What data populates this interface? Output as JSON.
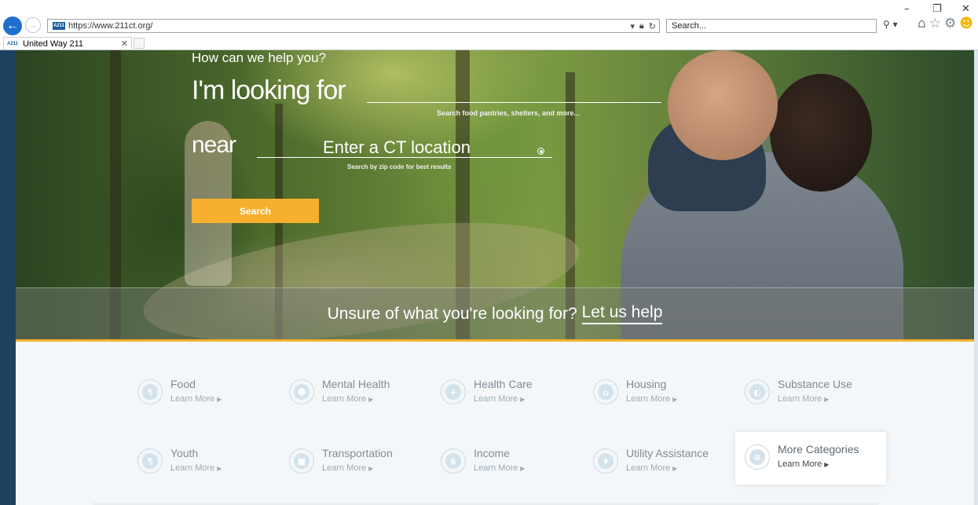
{
  "browser": {
    "url": "https://www.211ct.org/",
    "search_placeholder": "Search...",
    "tab_title": "United Way 211",
    "favicon_text": "A211"
  },
  "hero": {
    "question": "How can we help you?",
    "looking_label": "I'm looking for",
    "looking_hint": "Search food pantries, shelters, and more...",
    "near_label": "near",
    "location_placeholder": "Enter a CT location",
    "location_hint": "Search by zip code for best results",
    "search_button": "Search"
  },
  "help_band": {
    "text": "Unsure of what you're looking for?",
    "link": "Let us help"
  },
  "categories": {
    "learn_more": "Learn More",
    "items": [
      {
        "title": "Food",
        "icon": "utensils-icon",
        "glyph": "¶"
      },
      {
        "title": "Mental Health",
        "icon": "head-icon",
        "glyph": "☻"
      },
      {
        "title": "Health Care",
        "icon": "medical-kit-icon",
        "glyph": "+"
      },
      {
        "title": "Housing",
        "icon": "house-icon",
        "glyph": "⌂"
      },
      {
        "title": "Substance Use",
        "icon": "pill-icon",
        "glyph": "◐"
      },
      {
        "title": "Youth",
        "icon": "children-icon",
        "glyph": "¶"
      },
      {
        "title": "Transportation",
        "icon": "bus-icon",
        "glyph": "■"
      },
      {
        "title": "Income",
        "icon": "coin-icon",
        "glyph": "$"
      },
      {
        "title": "Utility Assistance",
        "icon": "lightbulb-icon",
        "glyph": "♦"
      },
      {
        "title": "More Categories",
        "icon": "list-icon",
        "glyph": "≡"
      }
    ]
  },
  "colors": {
    "accent": "#f6b02e",
    "back_button": "#1e6fd0",
    "category_text": "#7f8c97"
  }
}
